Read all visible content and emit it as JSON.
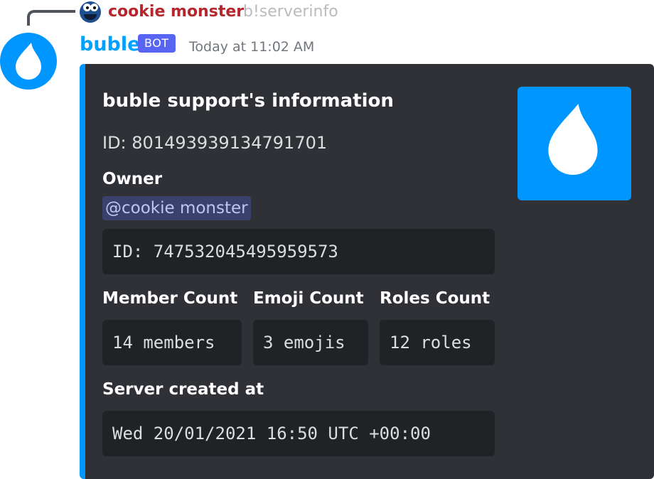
{
  "reply": {
    "author": "cookie monster",
    "content": "b!serverinfo"
  },
  "message": {
    "author": "buble",
    "bot_tag": "BOT",
    "timestamp": "Today at 11:02 AM"
  },
  "embed": {
    "accent_color": "#0096ff",
    "title": "buble support's information",
    "description": "ID: 801493939134791701",
    "fields": {
      "owner": {
        "name": "Owner",
        "mention": "@cookie monster",
        "value": "ID: 747532045495959573"
      },
      "members": {
        "name": "Member Count",
        "value": "14 members"
      },
      "emojis": {
        "name": "Emoji Count",
        "value": "3 emojis"
      },
      "roles": {
        "name": "Roles Count",
        "value": "12 roles"
      },
      "created": {
        "name": "Server created at",
        "value": "Wed 20/01/2021 16:50 UTC +00:00"
      }
    }
  },
  "icons": {
    "reply_avatar": "cookie-monster-avatar-icon",
    "bot_avatar": "water-drop-icon",
    "thumbnail": "water-drop-icon"
  }
}
